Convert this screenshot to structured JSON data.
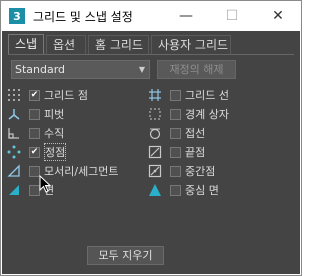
{
  "window": {
    "app_icon": "3",
    "title": "그리드 및 스냅 설정",
    "minimize": "—",
    "maximize": "☐",
    "close": "✕"
  },
  "tabs": [
    "스냅",
    "옵션",
    "홈 그리드",
    "사용자 그리드"
  ],
  "active_tab": 0,
  "preset": {
    "value": "Standard"
  },
  "reset_button": "재정의 해제",
  "snaps_left": [
    {
      "label": "그리드 점",
      "checked": true,
      "icon": "grid-points-icon"
    },
    {
      "label": "피벗",
      "checked": false,
      "icon": "pivot-icon"
    },
    {
      "label": "수직",
      "checked": false,
      "icon": "perpendicular-icon"
    },
    {
      "label": "정점",
      "checked": true,
      "icon": "vertex-icon"
    },
    {
      "label": "모서리/세그먼트",
      "checked": false,
      "icon": "edge-segment-icon"
    },
    {
      "label": "면",
      "checked": false,
      "icon": "face-icon"
    }
  ],
  "snaps_right": [
    {
      "label": "그리드 선",
      "checked": false,
      "icon": "grid-lines-icon"
    },
    {
      "label": "경계 상자",
      "checked": false,
      "icon": "bounding-box-icon"
    },
    {
      "label": "접선",
      "checked": false,
      "icon": "tangent-icon"
    },
    {
      "label": "끝점",
      "checked": false,
      "icon": "endpoint-icon"
    },
    {
      "label": "중간점",
      "checked": false,
      "icon": "midpoint-icon"
    },
    {
      "label": "중심 면",
      "checked": false,
      "icon": "center-face-icon"
    }
  ],
  "clear_all_button": "모두 지우기",
  "colors": {
    "panel_bg": "#444444",
    "accent_teal": "#1c8fa8"
  }
}
